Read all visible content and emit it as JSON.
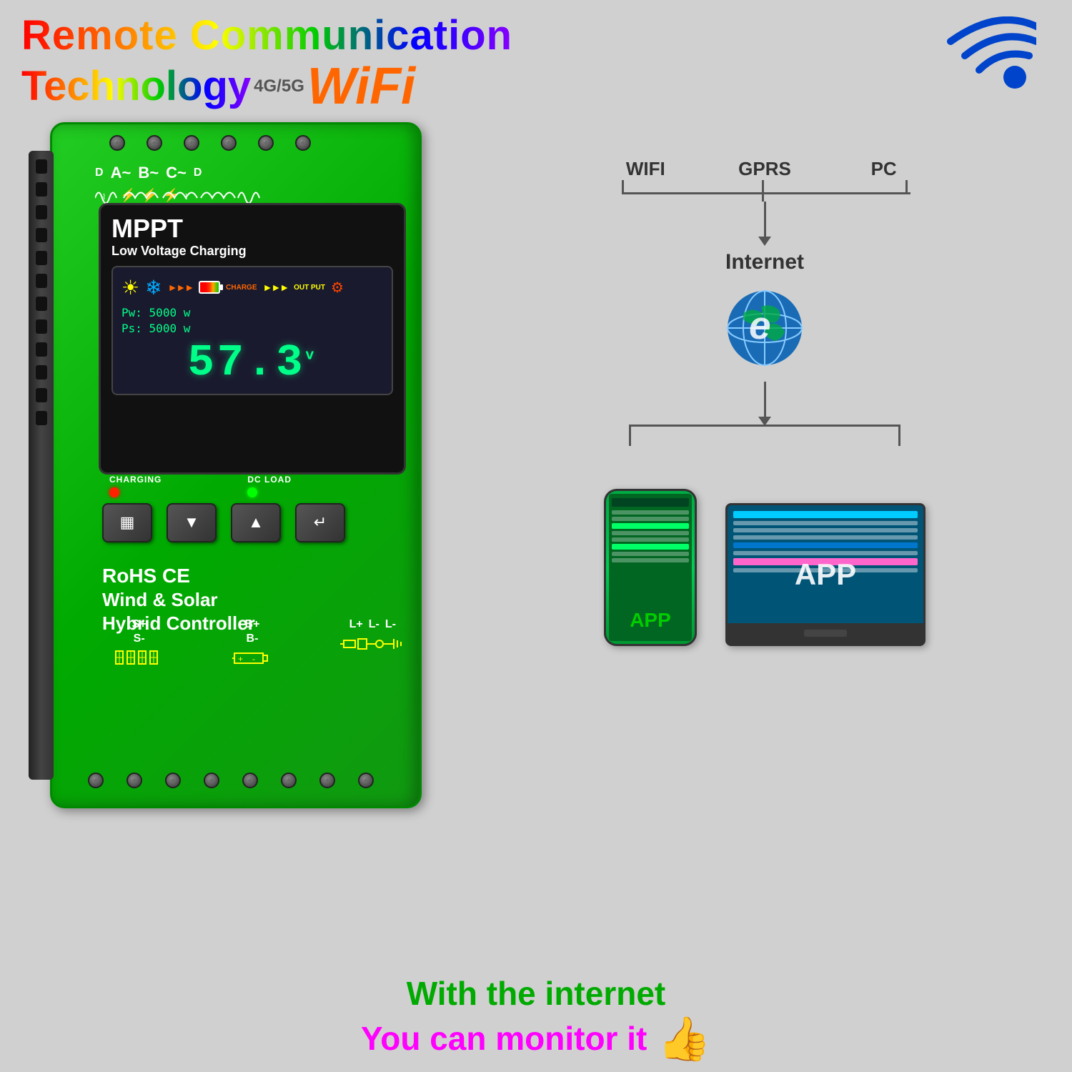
{
  "header": {
    "line1": "Remote Communication",
    "line2_tech": "Technology",
    "line2_4g5g": "4G/5G",
    "line2_wifi": "WiFi"
  },
  "device": {
    "title": "MPPT",
    "subtitle": "Low Voltage Charging",
    "power1_label": "Pw:",
    "power1_value": "5000 w",
    "power2_label": "Ps:",
    "power2_value": "5000 w",
    "voltage_value": "57.3",
    "voltage_unit": "v",
    "charging_label": "CHARGING",
    "dcload_label": "DC LOAD",
    "rohs_line1": "RoHS CE",
    "rohs_line2": "Wind & Solar",
    "rohs_line3": "Hybrid  Controller",
    "terminal_sp": "S+",
    "terminal_sm": "S-",
    "terminal_bp": "B+",
    "terminal_bm": "B-",
    "terminal_lp": "L+",
    "terminal_lm1": "L-",
    "terminal_lm2": "L-"
  },
  "comm_diagram": {
    "node_wifi": "WIFI",
    "node_gprs": "GPRS",
    "node_pc": "PC",
    "internet_label": "Internet",
    "app_label": "APP",
    "app_label_monitor": "APP"
  },
  "bottom_text": {
    "line1": "With the internet",
    "line2": "You can monitor it"
  }
}
